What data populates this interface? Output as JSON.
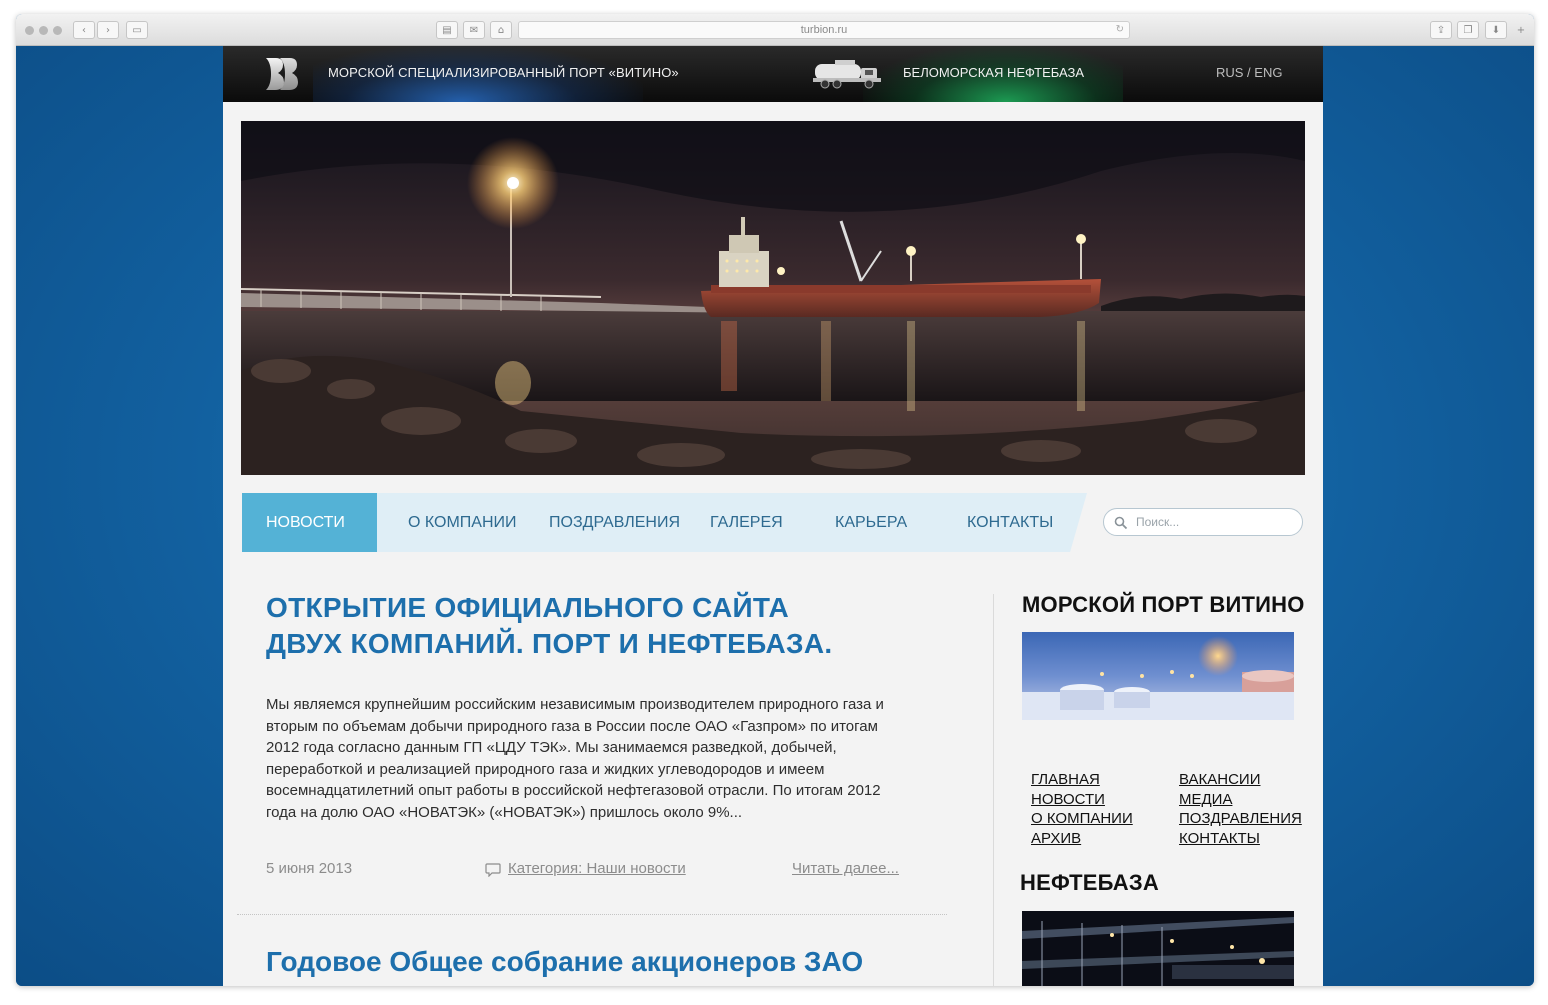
{
  "browser": {
    "url": "turbion.ru"
  },
  "header": {
    "port_title": "МОРСКОЙ СПЕЦИАЛИЗИРОВАННЫЙ ПОРТ «ВИТИНО»",
    "oil_title": "БЕЛОМОРСКАЯ НЕФТЕБАЗА",
    "language": "RUS / ENG"
  },
  "nav": {
    "items": [
      {
        "label": "НОВОСТИ",
        "active": true
      },
      {
        "label": "О КОМПАНИИ"
      },
      {
        "label": "ПОЗДРАВЛЕНИЯ"
      },
      {
        "label": "ГАЛЕРЕЯ"
      },
      {
        "label": "КАРЬЕРА"
      },
      {
        "label": "КОНТАКТЫ"
      }
    ],
    "search_placeholder": "Поиск..."
  },
  "articles": [
    {
      "title": "Открытие официального сайта двух компаний. Порт и нефтебаза.",
      "text": "Мы являемся крупнейшим российским независимым производителем природного газа и вторым по объемам добычи природного газа в России после ОАО «Газпром» по итогам 2012 года  согласно данным ГП «ЦДУ ТЭК». Мы занимаемся разведкой, добычей, переработкой и реализацией природного газа и жидких углеводородов и имеем восемнадцатилетний опыт работы в российской нефтегазовой отрасли. По итогам 2012 года на долю ОАО «НОВАТЭК» («НОВАТЭК») пришлось около 9%...",
      "date": "5 июня 2013",
      "category": "Категория: Наши новости",
      "read_more": "Читать далее..."
    },
    {
      "title": "Годовое Общее собрание акционеров ЗАО"
    }
  ],
  "sidebar": {
    "port_title": "МОРСКОЙ ПОРТ ВИТИНО",
    "links_left": [
      "ГЛАВНАЯ",
      "НОВОСТИ",
      "О КОМПАНИИ",
      "АРХИВ"
    ],
    "links_right": [
      "ВАКАНСИИ",
      "МЕДИА",
      "ПОЗДРАВЛЕНИЯ",
      "КОНТАКТЫ"
    ],
    "oil_title": "НЕФТЕБАЗА"
  },
  "colors": {
    "accent": "#1d6fac",
    "nav_active": "#54b2d6",
    "background_blue": "#1565a8"
  }
}
